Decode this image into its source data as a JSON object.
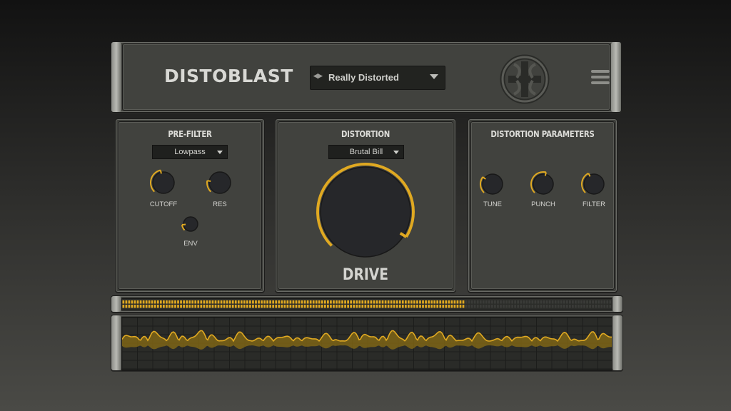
{
  "header": {
    "title": "DISTOBLAST",
    "preset_arrows": "◀▶",
    "preset_name": "Really Distorted",
    "logo_icon": "distoblast-logo-icon",
    "menu_icon": "hamburger-menu-icon"
  },
  "prefilter": {
    "title": "PRE-FILTER",
    "type": "Lowpass",
    "knobs": [
      {
        "label": "CUTOFF",
        "value": 0.45
      },
      {
        "label": "RES",
        "value": 0.2
      },
      {
        "label": "ENV",
        "value": 0.15
      }
    ]
  },
  "distortion": {
    "title": "DISTORTION",
    "type": "Brutal Bill",
    "drive_label": "DRIVE",
    "drive_value": 0.95
  },
  "parameters": {
    "title": "DISTORTION PARAMETERS",
    "knobs": [
      {
        "label": "TUNE",
        "value": 0.3
      },
      {
        "label": "PUNCH",
        "value": 0.55
      },
      {
        "label": "FILTER",
        "value": 0.4
      }
    ]
  },
  "meter": {
    "level": 0.7
  },
  "colors": {
    "accent": "#e0a921",
    "panel": "#41423e",
    "knob": "#26272a"
  }
}
